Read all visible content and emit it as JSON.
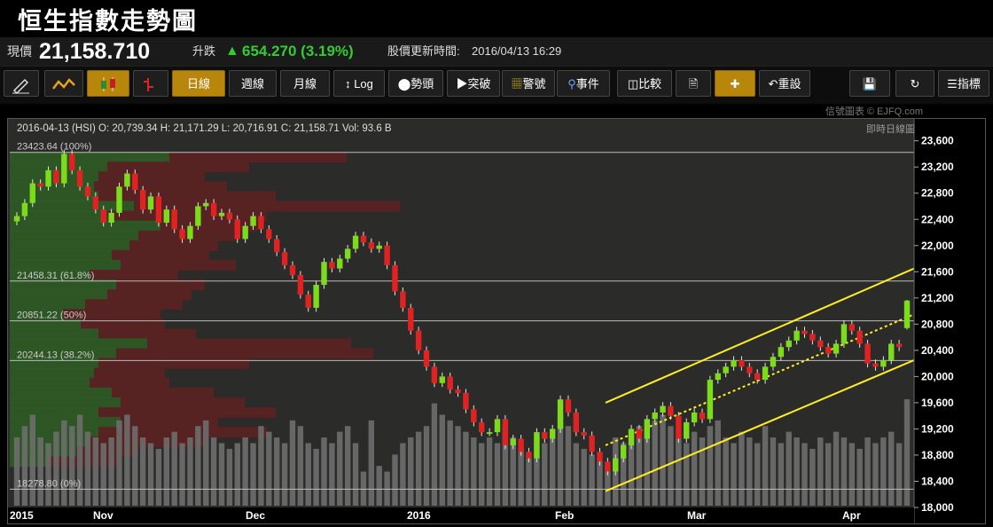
{
  "header": {
    "title": "恒生指數走勢圖"
  },
  "quote": {
    "price_label": "現價",
    "price": "21,158.710",
    "change_label": "升跌",
    "change": "654.270 (3.19%)",
    "update_label": "股價更新時間:",
    "update_time": "2016/04/13 16:29"
  },
  "toolbar": {
    "day": "日線",
    "week": "週線",
    "month": "月線",
    "log": "Log",
    "trend": "勢頭",
    "breakout": "突破",
    "warning": "警號",
    "event": "事件",
    "compare": "比較",
    "reset": "重設",
    "indicator": "指標"
  },
  "credit": "信號圖表 © EJFQ.com",
  "chart_data": {
    "type": "candlestick",
    "ohlc_label": "2016-04-13 (HSI) O: 20,739.34  H: 21,171.29  L: 20,716.91  C: 21,158.71  Vol: 93.6 B",
    "realtime_label": "即時日線圖",
    "y_ticks": [
      "23,600",
      "23,200",
      "22,800",
      "22,400",
      "22,000",
      "21,600",
      "21,200",
      "20,800",
      "20,400",
      "20,000",
      "19,600",
      "19,200",
      "18,800",
      "18,400",
      "18,000"
    ],
    "x_labels": [
      "2015",
      "Nov",
      "Dec",
      "2016",
      "Feb",
      "Mar",
      "Apr"
    ],
    "ylim": [
      18000,
      23650
    ],
    "fib_levels": [
      {
        "value": 23423.64,
        "label": "23423.64 (100%)"
      },
      {
        "value": 21458.31,
        "label": "21458.31 (61.8%)"
      },
      {
        "value": 20851.22,
        "label": "20851.22 (50%)"
      },
      {
        "value": 20244.13,
        "label": "20244.13 (38.2%)"
      },
      {
        "value": 18278.8,
        "label": "18278.80 (0%)"
      }
    ],
    "colors": {
      "up": "#7cdc1c",
      "down": "#e02222",
      "channel": "#ffee22",
      "bg": "#2b2b29"
    },
    "closes": [
      22450,
      22650,
      22950,
      22900,
      23150,
      22950,
      23400,
      23150,
      22900,
      22750,
      22550,
      22350,
      22500,
      22900,
      23100,
      22850,
      22550,
      22750,
      22350,
      22550,
      22250,
      22100,
      22300,
      22600,
      22650,
      22450,
      22500,
      22400,
      22100,
      22300,
      22450,
      22250,
      22100,
      21900,
      21700,
      21550,
      21250,
      21050,
      21400,
      21750,
      21650,
      21800,
      21950,
      22150,
      22050,
      21950,
      22000,
      21700,
      21300,
      21050,
      20700,
      20400,
      20150,
      19900,
      20000,
      19800,
      19750,
      19500,
      19300,
      19150,
      19150,
      19350,
      18950,
      19050,
      18850,
      18750,
      19150,
      19050,
      19200,
      19650,
      19450,
      19150,
      19100,
      18850,
      18700,
      18550,
      18750,
      18950,
      19200,
      19050,
      19350,
      19450,
      19550,
      19400,
      19050,
      19300,
      19450,
      19350,
      19950,
      20050,
      20150,
      20250,
      20150,
      20050,
      19950,
      20150,
      20300,
      20450,
      20550,
      20700,
      20650,
      20550,
      20450,
      20350,
      20500,
      20800,
      20700,
      20500,
      20200,
      20150,
      20250,
      20500,
      20450,
      21158.71
    ],
    "volumes": [
      60,
      70,
      80,
      60,
      55,
      65,
      75,
      70,
      80,
      65,
      60,
      55,
      60,
      75,
      80,
      70,
      60,
      55,
      50,
      60,
      65,
      55,
      60,
      70,
      75,
      60,
      55,
      50,
      55,
      60,
      55,
      70,
      65,
      60,
      55,
      75,
      70,
      55,
      50,
      60,
      55,
      65,
      70,
      55,
      30,
      75,
      35,
      30,
      45,
      55,
      60,
      65,
      70,
      90,
      80,
      75,
      70,
      65,
      60,
      55,
      60,
      55,
      70,
      60,
      50,
      45,
      60,
      55,
      60,
      80,
      70,
      55,
      50,
      45,
      40,
      35,
      60,
      55,
      65,
      70,
      60,
      75,
      80,
      70,
      60,
      55,
      65,
      60,
      70,
      75,
      60,
      55,
      65,
      60,
      55,
      70,
      60,
      55,
      65,
      60,
      55,
      50,
      60,
      55,
      65,
      60,
      55,
      50,
      60,
      55,
      60,
      65,
      55,
      93.6
    ],
    "volume_profile": [
      {
        "price": 23350,
        "green": 180,
        "red": 200
      },
      {
        "price": 23200,
        "green": 110,
        "red": 160
      },
      {
        "price": 23050,
        "green": 100,
        "red": 120
      },
      {
        "price": 22900,
        "green": 95,
        "red": 150
      },
      {
        "price": 22750,
        "green": 100,
        "red": 200
      },
      {
        "price": 22600,
        "green": 140,
        "red": 300
      },
      {
        "price": 22450,
        "green": 110,
        "red": 180
      },
      {
        "price": 22300,
        "green": 170,
        "red": 110
      },
      {
        "price": 22150,
        "green": 145,
        "red": 110
      },
      {
        "price": 22000,
        "green": 135,
        "red": 100
      },
      {
        "price": 21850,
        "green": 115,
        "red": 110
      },
      {
        "price": 21700,
        "green": 125,
        "red": 130
      },
      {
        "price": 21550,
        "green": 90,
        "red": 100
      },
      {
        "price": 21400,
        "green": 120,
        "red": 100
      },
      {
        "price": 21250,
        "green": 110,
        "red": 95
      },
      {
        "price": 21100,
        "green": 85,
        "red": 110
      },
      {
        "price": 20950,
        "green": 60,
        "red": 110
      },
      {
        "price": 20800,
        "green": 80,
        "red": 95
      },
      {
        "price": 20650,
        "green": 100,
        "red": 110
      },
      {
        "price": 20500,
        "green": 155,
        "red": 230
      },
      {
        "price": 20350,
        "green": 120,
        "red": 290
      },
      {
        "price": 20200,
        "green": 100,
        "red": 170
      },
      {
        "price": 20050,
        "green": 95,
        "red": 80
      },
      {
        "price": 19900,
        "green": 90,
        "red": 90
      },
      {
        "price": 19750,
        "green": 115,
        "red": 115
      },
      {
        "price": 19600,
        "green": 125,
        "red": 140
      },
      {
        "price": 19450,
        "green": 100,
        "red": 200
      },
      {
        "price": 19300,
        "green": 125,
        "red": 110
      },
      {
        "price": 19150,
        "green": 100,
        "red": 190
      },
      {
        "price": 19000,
        "green": 90,
        "red": 130
      },
      {
        "price": 18850,
        "green": 75,
        "red": 70
      },
      {
        "price": 18700,
        "green": 45,
        "red": 80
      }
    ],
    "channel": {
      "upper": [
        [
          674,
          19600
        ],
        [
          1022,
          21650
        ]
      ],
      "middle": [
        [
          674,
          18950
        ],
        [
          1022,
          20950
        ]
      ],
      "lower": [
        [
          674,
          18250
        ],
        [
          1022,
          20250
        ]
      ]
    }
  }
}
